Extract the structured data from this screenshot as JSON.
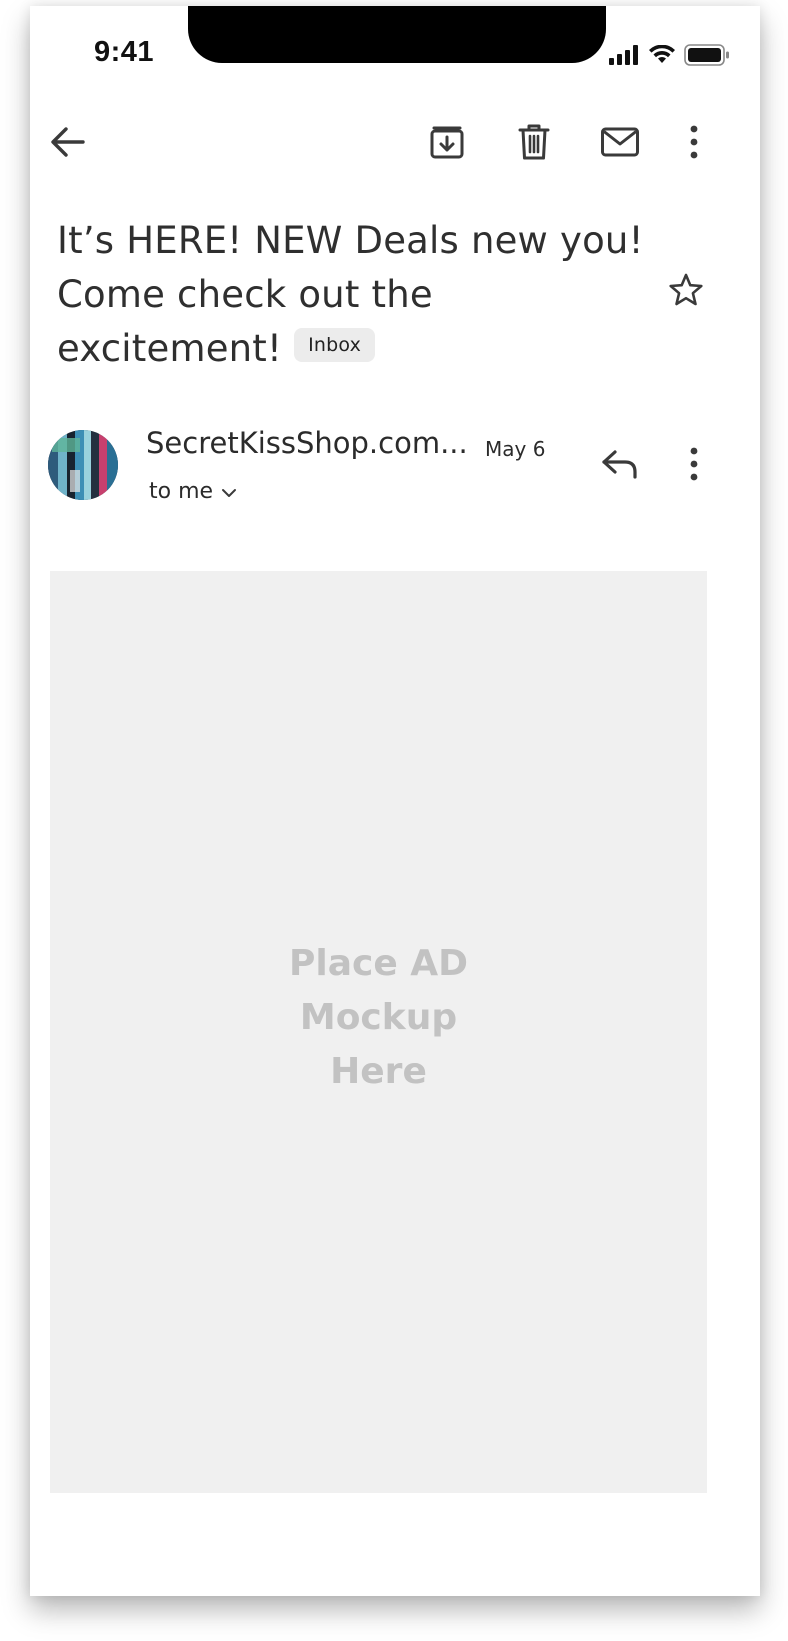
{
  "status_bar": {
    "time": "9:41",
    "icons": [
      "cellular-signal-icon",
      "wifi-icon",
      "battery-icon"
    ]
  },
  "toolbar": {
    "icons": [
      "back-arrow-icon",
      "archive-icon",
      "trash-icon",
      "mail-icon",
      "more-vert-icon"
    ]
  },
  "email": {
    "subject_line_1": "It’s HERE! NEW Deals new you!",
    "subject_line_2": "Come check out the",
    "subject_line_3": "excitement!",
    "label": "Inbox",
    "sender": "SecretKissShop.com...",
    "date": "May 6",
    "recipient": "to me",
    "starred": false
  },
  "ad_placeholder": {
    "line_1": "Place AD",
    "line_2": "Mockup",
    "line_3": "Here"
  },
  "colors": {
    "text": "#2b2b2b",
    "badge_bg": "#ececec",
    "ad_bg": "#f0f0f0",
    "ad_text": "#c2c2c2",
    "icon": "#3a3a3a"
  }
}
